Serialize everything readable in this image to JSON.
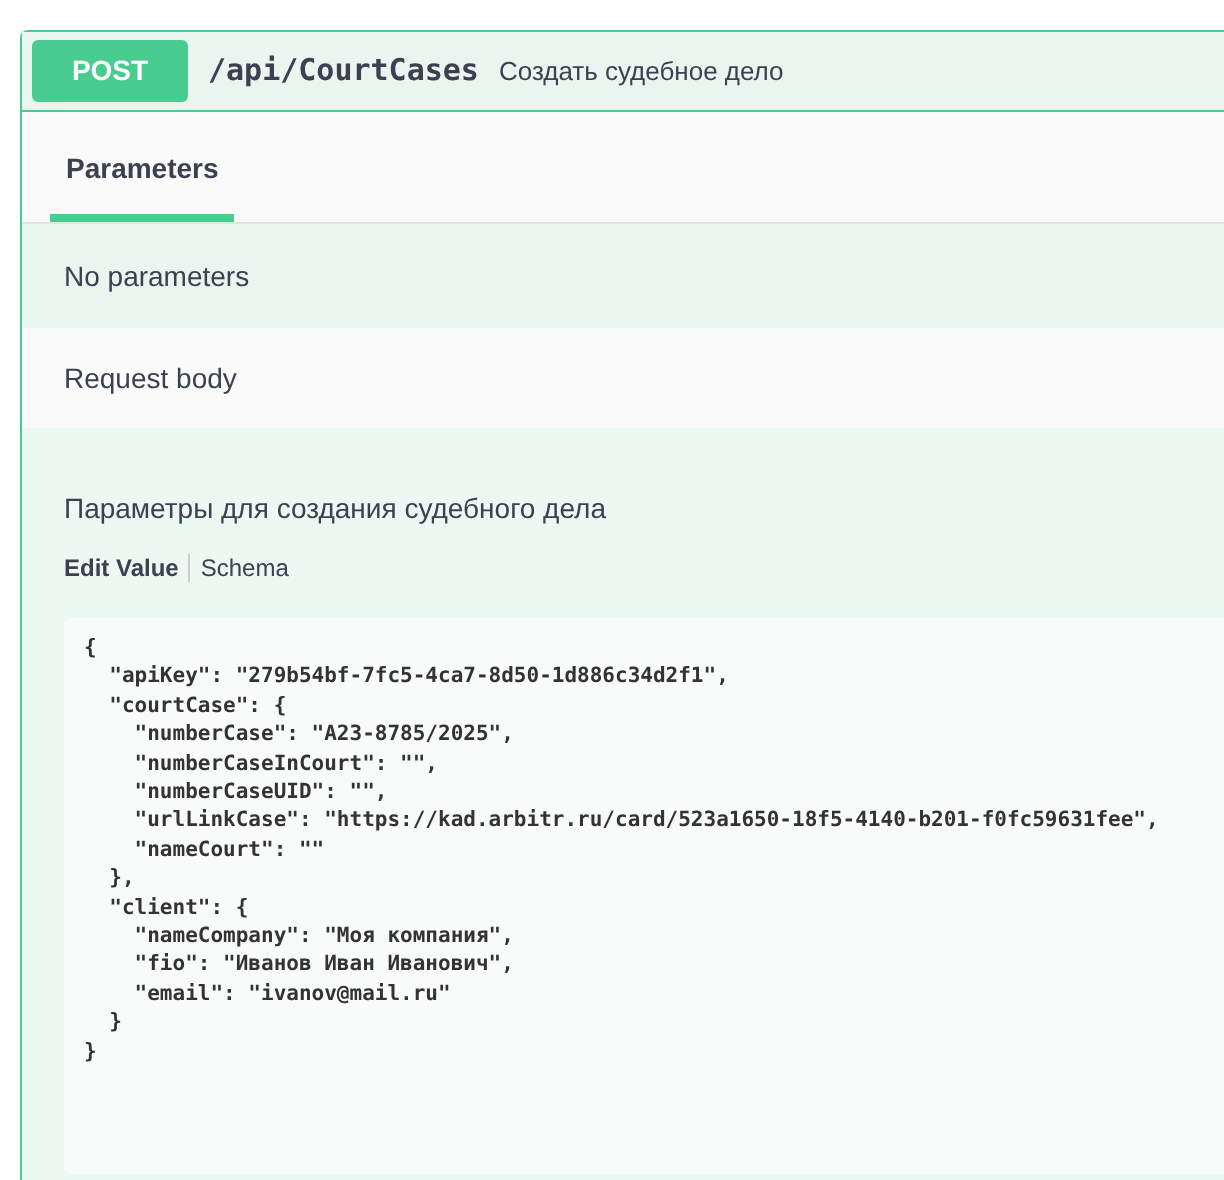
{
  "operation": {
    "method": "POST",
    "path": "/api/CourtCases",
    "summary": "Создать судебное дело"
  },
  "tabs": [
    {
      "label": "Parameters",
      "selected": true
    }
  ],
  "parameters_message": "No parameters",
  "request_body": {
    "title": "Request body",
    "description": "Параметры для создания судебного дела",
    "view_tabs": [
      {
        "label": "Edit Value",
        "selected": true
      },
      {
        "label": "Schema",
        "selected": false
      }
    ],
    "example_lines": [
      "{",
      "  \"apiKey\": \"279b54bf-7fc5-4ca7-8d50-1d886c34d2f1\",",
      "  \"courtCase\": {",
      "    \"numberCase\": \"A23-8785/2025\",",
      "    \"numberCaseInCourt\": \"\",",
      "    \"numberCaseUID\": \"\",",
      "    \"urlLinkCase\": \"https://kad.arbitr.ru/card/523a1650-18f5-4140-b201-f0fc59631fee\",",
      "    \"nameCourt\": \"\"",
      "  },",
      "  \"client\": {",
      "    \"nameCompany\": \"Моя компания\",",
      "    \"fio\": \"Иванов Иван Иванович\",",
      "    \"email\": \"ivanov@mail.ru\"",
      "  }",
      "}"
    ]
  }
}
